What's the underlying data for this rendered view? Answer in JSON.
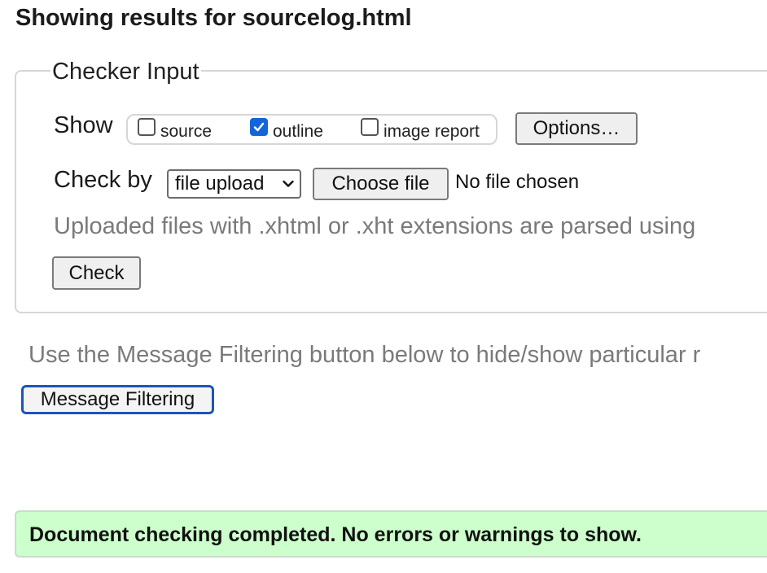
{
  "page": {
    "title": "Showing results for sourcelog.html"
  },
  "checker": {
    "legend": "Checker Input",
    "show_label": "Show",
    "show_options": [
      {
        "label": "source",
        "checked": false
      },
      {
        "label": "outline",
        "checked": true
      },
      {
        "label": "image report",
        "checked": false
      }
    ],
    "options_button": "Options…",
    "check_by_label": "Check by",
    "check_by_selected": "file upload",
    "choose_file_button": "Choose file",
    "no_file_text": "No file chosen",
    "hint": "Uploaded files with .xhtml or .xht extensions are parsed using",
    "check_button": "Check"
  },
  "filtering": {
    "note": "Use the Message Filtering button below to hide/show particular r",
    "button": "Message Filtering"
  },
  "result": {
    "message": "Document checking completed. No errors or warnings to show."
  },
  "colors": {
    "checkbox_checked": "#1466d8",
    "focus_outline": "#1a56b7",
    "success_bg": "#ccffcc",
    "muted_text": "#7a7a7a"
  },
  "icons": {
    "checkmark": "check-icon",
    "select_arrow": "chevron-down-icon"
  }
}
